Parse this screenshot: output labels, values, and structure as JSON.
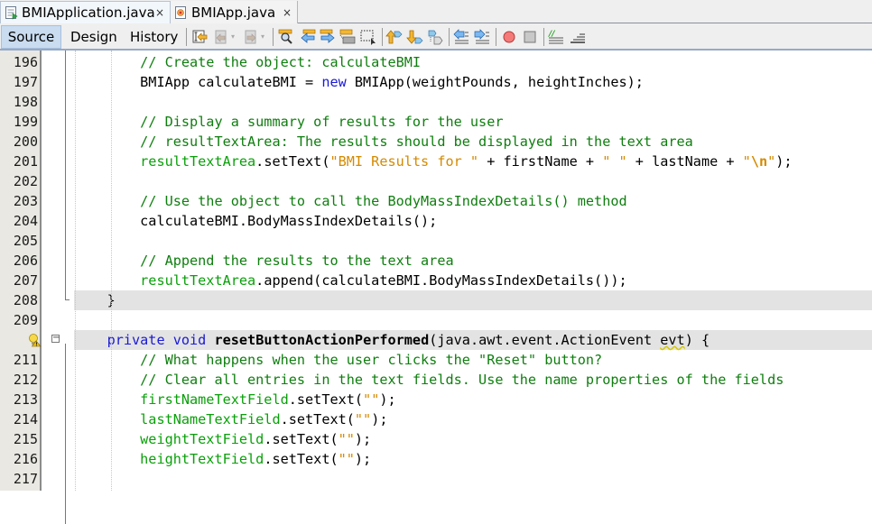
{
  "tabs": [
    {
      "label": "BMIApplication.java",
      "icon": "java-form-file-icon",
      "active": true,
      "close": "×"
    },
    {
      "label": "BMIApp.java",
      "icon": "java-class-file-icon",
      "active": false,
      "close": "×"
    }
  ],
  "toolbar": {
    "view_tabs": [
      {
        "label": "Source",
        "active": true
      },
      {
        "label": "Design",
        "active": false
      },
      {
        "label": "History",
        "active": false
      }
    ],
    "buttons": [
      "last-edit-icon",
      "back-icon",
      "forward-icon",
      "find-selection-icon",
      "find-previous-icon",
      "find-next-icon",
      "toggle-highlight-icon",
      "toggle-rect-selection-icon",
      "previous-bookmark-icon",
      "next-bookmark-icon",
      "toggle-bookmark-icon",
      "shift-left-icon",
      "shift-right-icon",
      "start-macro-icon",
      "stop-macro-icon",
      "comment-icon",
      "uncomment-icon"
    ]
  },
  "editor": {
    "lines": [
      {
        "num": "196",
        "tokens": [
          [
            "ind",
            "        "
          ],
          [
            "cm",
            "// Create the object: calculateBMI"
          ]
        ]
      },
      {
        "num": "197",
        "tokens": [
          [
            "ind",
            "        "
          ],
          [
            "pl",
            "BMIApp calculateBMI = "
          ],
          [
            "kw",
            "new"
          ],
          [
            "pl",
            " BMIApp(weightPounds, heightInches);"
          ]
        ]
      },
      {
        "num": "198",
        "tokens": []
      },
      {
        "num": "199",
        "tokens": [
          [
            "ind",
            "        "
          ],
          [
            "cm",
            "// Display a summary of results for the user"
          ]
        ]
      },
      {
        "num": "200",
        "tokens": [
          [
            "ind",
            "        "
          ],
          [
            "cm",
            "// resultTextArea: The results should be displayed in the text area"
          ]
        ]
      },
      {
        "num": "201",
        "tokens": [
          [
            "ind",
            "        "
          ],
          [
            "fld",
            "resultTextArea"
          ],
          [
            "pl",
            ".setText("
          ],
          [
            "str",
            "\"BMI Results for \""
          ],
          [
            "pl",
            " + firstName + "
          ],
          [
            "str",
            "\" \""
          ],
          [
            "pl",
            " + lastName + "
          ],
          [
            "str",
            "\""
          ],
          [
            "esc",
            "\\n"
          ],
          [
            "str",
            "\""
          ],
          [
            "pl",
            ");"
          ]
        ]
      },
      {
        "num": "202",
        "tokens": []
      },
      {
        "num": "203",
        "tokens": [
          [
            "ind",
            "        "
          ],
          [
            "cm",
            "// Use the object to call the BodyMassIndexDetails() method"
          ]
        ]
      },
      {
        "num": "204",
        "tokens": [
          [
            "ind",
            "        "
          ],
          [
            "pl",
            "calculateBMI.BodyMassIndexDetails();"
          ]
        ]
      },
      {
        "num": "205",
        "tokens": []
      },
      {
        "num": "206",
        "tokens": [
          [
            "ind",
            "        "
          ],
          [
            "cm",
            "// Append the results to the text area"
          ]
        ]
      },
      {
        "num": "207",
        "tokens": [
          [
            "ind",
            "        "
          ],
          [
            "fld",
            "resultTextArea"
          ],
          [
            "pl",
            ".append(calculateBMI.BodyMassIndexDetails());"
          ]
        ]
      },
      {
        "num": "208",
        "highlight": true,
        "tokens": [
          [
            "ind",
            "    "
          ],
          [
            "pl",
            "}"
          ]
        ]
      },
      {
        "num": "209",
        "tokens": []
      },
      {
        "num": "",
        "hint": "warning-lightbulb-icon",
        "fold": "collapse-icon",
        "highlight": true,
        "tokens": [
          [
            "ind",
            "    "
          ],
          [
            "kw",
            "private"
          ],
          [
            "pl",
            " "
          ],
          [
            "kw",
            "void"
          ],
          [
            "pl",
            " "
          ],
          [
            "b",
            "resetButtonActionPerformed"
          ],
          [
            "pl",
            "(java.awt.event.ActionEvent "
          ],
          [
            "wavy",
            "evt"
          ],
          [
            "pl",
            ") {"
          ]
        ]
      },
      {
        "num": "211",
        "tokens": [
          [
            "ind",
            "        "
          ],
          [
            "cm",
            "// What happens when the user clicks the \"Reset\" button?"
          ]
        ]
      },
      {
        "num": "212",
        "tokens": [
          [
            "ind",
            "        "
          ],
          [
            "cm",
            "// Clear all entries in the text fields. Use the name properties of the fields"
          ]
        ]
      },
      {
        "num": "213",
        "tokens": [
          [
            "ind",
            "        "
          ],
          [
            "fld",
            "firstNameTextField"
          ],
          [
            "pl",
            ".setText("
          ],
          [
            "str",
            "\"\""
          ],
          [
            "pl",
            ");"
          ]
        ]
      },
      {
        "num": "214",
        "tokens": [
          [
            "ind",
            "        "
          ],
          [
            "fld",
            "lastNameTextField"
          ],
          [
            "pl",
            ".setText("
          ],
          [
            "str",
            "\"\""
          ],
          [
            "pl",
            ");"
          ]
        ]
      },
      {
        "num": "215",
        "tokens": [
          [
            "ind",
            "        "
          ],
          [
            "fld",
            "weightTextField"
          ],
          [
            "pl",
            ".setText("
          ],
          [
            "str",
            "\"\""
          ],
          [
            "pl",
            ");"
          ]
        ]
      },
      {
        "num": "216",
        "tokens": [
          [
            "ind",
            "        "
          ],
          [
            "fld",
            "heightTextField"
          ],
          [
            "pl",
            ".setText("
          ],
          [
            "str",
            "\"\""
          ],
          [
            "pl",
            ");"
          ]
        ]
      },
      {
        "num": "217",
        "tokens": []
      }
    ]
  },
  "colors": {
    "comment": "#0f7e0f",
    "keyword": "#1a1ad6",
    "field": "#0aa00a",
    "string": "#d48a00",
    "highlight_line": "#e3e3e3",
    "source_tab": "#c9dcf0"
  }
}
